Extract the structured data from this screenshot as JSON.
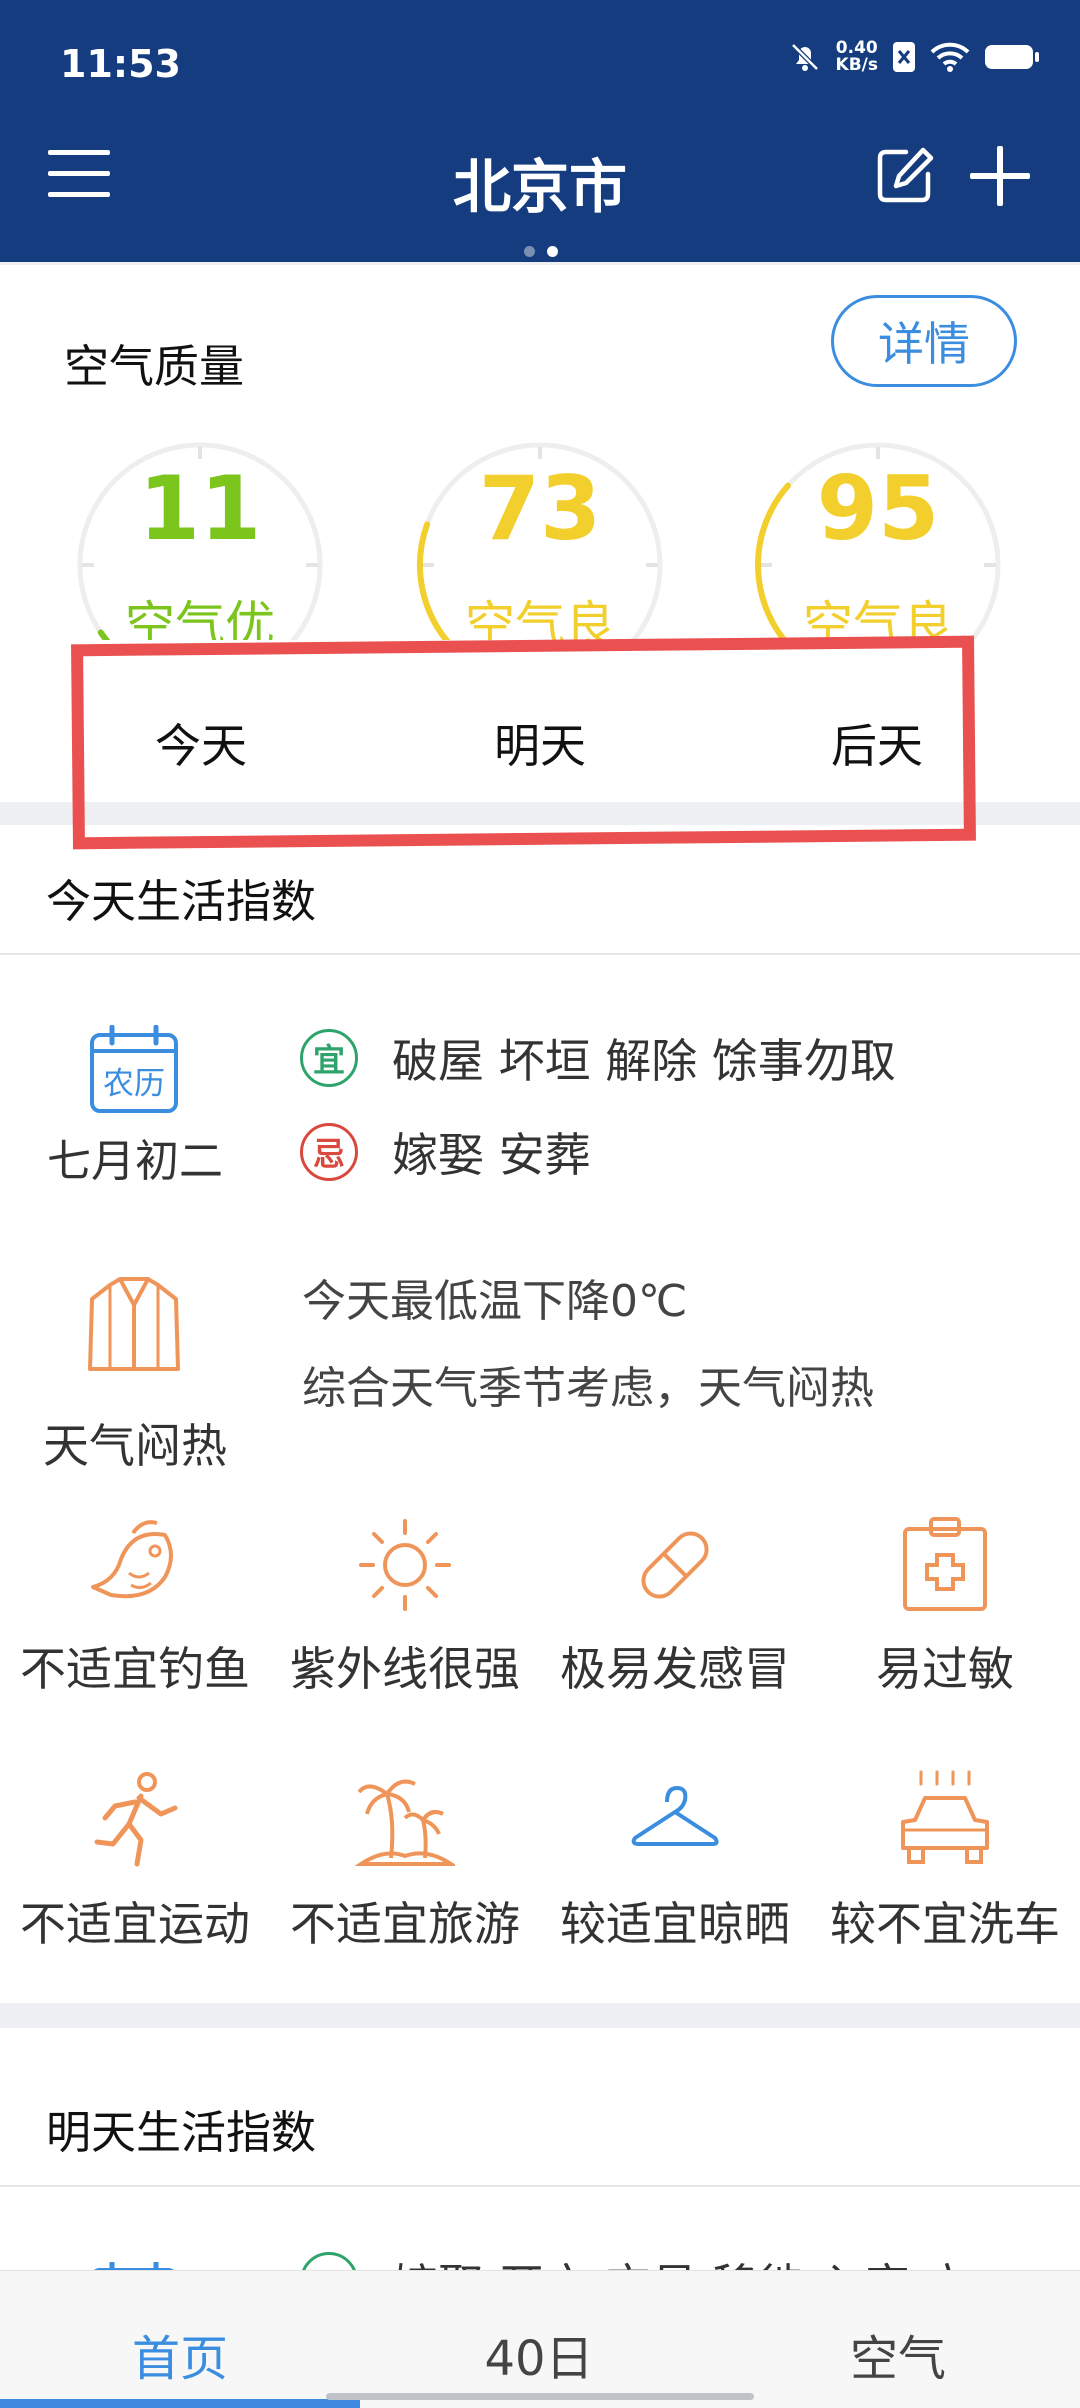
{
  "status": {
    "time": "11:53",
    "speed_value": "0.40",
    "speed_unit": "KB/s"
  },
  "header": {
    "city": "北京市"
  },
  "air": {
    "title": "空气质量",
    "detail_label": "详情",
    "days": [
      {
        "day": "今天",
        "aqi": "11",
        "level": "空气优",
        "color": "#7cc51c",
        "aqi_fraction": 0.04
      },
      {
        "day": "明天",
        "aqi": "73",
        "level": "空气良",
        "color": "#f2cf2c",
        "aqi_fraction": 0.24
      },
      {
        "day": "后天",
        "aqi": "95",
        "level": "空气良",
        "color": "#f2cf2c",
        "aqi_fraction": 0.32
      }
    ]
  },
  "today": {
    "title": "今天生活指数",
    "calendar_icon_label": "农历",
    "lunar_date": "七月初二",
    "yi_badge": "宜",
    "yi_text": "破屋 坏垣 解除 馀事勿取",
    "ji_badge": "忌",
    "ji_text": "嫁娶 安葬",
    "weather_label": "天气闷热",
    "temp_line1": "今天最低温下降0℃",
    "temp_line2": "综合天气季节考虑，天气闷热",
    "indices": [
      {
        "icon": "fish-icon",
        "label": "不适宜钓鱼"
      },
      {
        "icon": "sun-icon",
        "label": "紫外线很强"
      },
      {
        "icon": "pill-icon",
        "label": "极易发感冒"
      },
      {
        "icon": "medkit-icon",
        "label": "易过敏"
      },
      {
        "icon": "running-icon",
        "label": "不适宜运动"
      },
      {
        "icon": "palm-island-icon",
        "label": "不适宜旅游"
      },
      {
        "icon": "hanger-icon",
        "label": "较适宜晾晒"
      },
      {
        "icon": "car-wash-icon",
        "label": "较不宜洗车"
      }
    ]
  },
  "tomorrow": {
    "title": "明天生活指数",
    "partial_text": "嫁娶 开市 交易 移徙 入宅 立"
  },
  "nav": {
    "home": "首页",
    "forty_day": "40日",
    "air": "空气"
  },
  "colors": {
    "header_bg": "#143c7e",
    "accent_blue": "#3b8de0",
    "icon_orange": "#f0955a",
    "highlight_red": "#ea5050"
  }
}
